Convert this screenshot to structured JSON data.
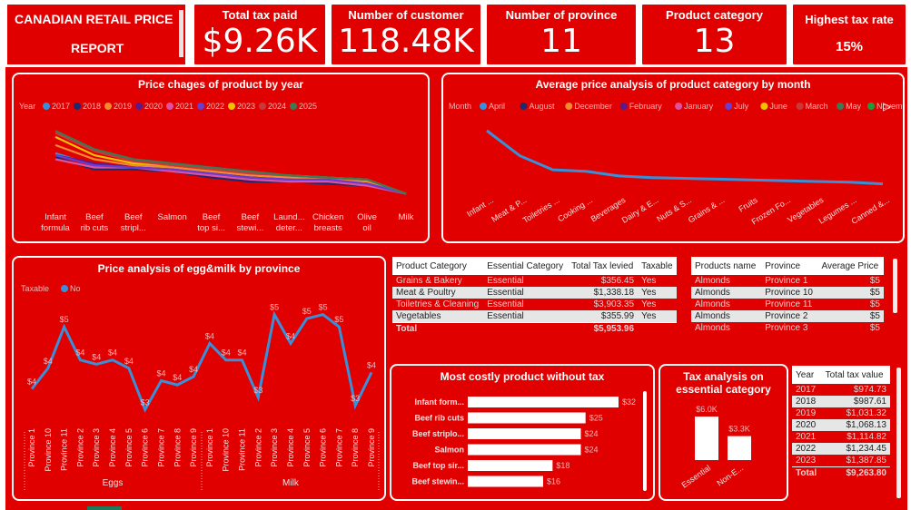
{
  "header": {
    "title_line1": "CANADIAN RETAIL PRICE",
    "title_line2": "REPORT"
  },
  "kpis": [
    {
      "label": "Total tax paid",
      "value": "$9.26K"
    },
    {
      "label": "Number of customer",
      "value": "118.48K"
    },
    {
      "label": "Number of province",
      "value": "11"
    },
    {
      "label": "Product category",
      "value": "13"
    },
    {
      "label": "Highest tax rate",
      "value": "15%"
    }
  ],
  "chart_data": [
    {
      "id": "price_by_year",
      "type": "line",
      "title": "Price chages of product by year",
      "legend_title": "Year",
      "categories": [
        "Infant formula",
        "Beef rib cuts",
        "Beef stripl...",
        "Salmon",
        "Beef top si...",
        "Beef stewi...",
        "Laund... deter...",
        "Chicken breasts",
        "Olive oil",
        "Milk"
      ],
      "series": [
        {
          "name": "2017",
          "color": "#3a8fd9",
          "values": [
            36,
            30,
            29,
            28,
            26,
            24,
            23,
            22,
            21,
            16
          ]
        },
        {
          "name": "2018",
          "color": "#1f2a6b",
          "values": [
            34,
            28,
            28,
            27,
            24,
            22,
            22,
            21,
            20,
            16
          ]
        },
        {
          "name": "2019",
          "color": "#f28a2e",
          "values": [
            40,
            33,
            30,
            29,
            27,
            25,
            24,
            23,
            22,
            16
          ]
        },
        {
          "name": "2020",
          "color": "#5b1a8c",
          "values": [
            35,
            31,
            29,
            28,
            26,
            24,
            23,
            22,
            21,
            16
          ]
        },
        {
          "name": "2021",
          "color": "#e0519e",
          "values": [
            33,
            29,
            29,
            27,
            25,
            23,
            22,
            22,
            20,
            16
          ]
        },
        {
          "name": "2022",
          "color": "#6a3ccf",
          "values": [
            35,
            30,
            29,
            28,
            26,
            24,
            23,
            23,
            21,
            16
          ]
        },
        {
          "name": "2023",
          "color": "#f2c200",
          "values": [
            44,
            35,
            31,
            30,
            28,
            26,
            25,
            24,
            23,
            16
          ]
        },
        {
          "name": "2024",
          "color": "#c8393c",
          "values": [
            46,
            37,
            32,
            30,
            28,
            26,
            25,
            24,
            23,
            16
          ]
        },
        {
          "name": "2025",
          "color": "#3c7a55",
          "values": [
            47,
            38,
            33,
            31,
            29,
            27,
            25,
            24,
            23,
            16
          ]
        }
      ]
    },
    {
      "id": "avg_price_by_month",
      "type": "line",
      "title": "Average price analysis of product category by month",
      "legend_title": "Month",
      "legend": [
        {
          "name": "April",
          "color": "#3a8fd9"
        },
        {
          "name": "August",
          "color": "#1f2a6b"
        },
        {
          "name": "December",
          "color": "#f28a2e"
        },
        {
          "name": "February",
          "color": "#5b1a8c"
        },
        {
          "name": "January",
          "color": "#e0519e"
        },
        {
          "name": "July",
          "color": "#6a3ccf"
        },
        {
          "name": "June",
          "color": "#f2c200"
        },
        {
          "name": "March",
          "color": "#c8393c"
        },
        {
          "name": "May",
          "color": "#3c7a55"
        },
        {
          "name": "November",
          "color": "#1a9e3a"
        }
      ],
      "categories": [
        "Infant ...",
        "Meat & P...",
        "Toiletries ...",
        "Cooking ...",
        "Beverages",
        "Dairy & E...",
        "Nuts & S...",
        "Grains & ...",
        "Fruits",
        "Frozen Fo...",
        "Vegetables",
        "Legumes ...",
        "Canned &..."
      ],
      "values": [
        36,
        20,
        11,
        10,
        7,
        6,
        5.5,
        5,
        4.5,
        4,
        3.5,
        3,
        2
      ]
    },
    {
      "id": "egg_milk_by_province",
      "type": "line",
      "title": "Price analysis of egg&milk by province",
      "legend_title": "Taxable",
      "series_name": "No",
      "groups": [
        {
          "name": "Eggs",
          "categories": [
            "Province 1",
            "Province 10",
            "Province 11",
            "Province 2",
            "Province 3",
            "Province 4",
            "Province 5",
            "Province 6",
            "Province 7",
            "Province 8",
            "Province 9"
          ],
          "values": [
            3.6,
            4.1,
            5.1,
            4.3,
            4.2,
            4.3,
            4.1,
            3.1,
            3.8,
            3.7,
            3.9
          ]
        },
        {
          "name": "Milk",
          "categories": [
            "Province 1",
            "Province 10",
            "Province 11",
            "Province 2",
            "Province 3",
            "Province 4",
            "Province 5",
            "Province 6",
            "Province 7",
            "Province 8",
            "Province 9"
          ],
          "values": [
            4.7,
            4.3,
            4.3,
            3.4,
            5.4,
            4.7,
            5.3,
            5.4,
            5.1,
            3.2,
            4.0
          ]
        }
      ],
      "labels": [
        "$4",
        "$4",
        "$5",
        "$4",
        "$4",
        "$4",
        "$4",
        "$3",
        "$4",
        "$4",
        "$4",
        "$4",
        "$4",
        "$4",
        "$3",
        "$5",
        "$4",
        "$5",
        "$5",
        "$5",
        "$3",
        "$4"
      ]
    },
    {
      "id": "most_costly",
      "type": "bar",
      "title": "Most costly product without tax",
      "categories": [
        "Infant form...",
        "Beef rib cuts",
        "Beef striplo...",
        "Salmon",
        "Beef top sir...",
        "Beef stewin..."
      ],
      "values": [
        32,
        25,
        24,
        24,
        18,
        16
      ],
      "labels": [
        "$32",
        "$25",
        "$24",
        "$24",
        "$18",
        "$16"
      ]
    },
    {
      "id": "tax_essential",
      "type": "bar",
      "title": "Tax analysis on essential category",
      "categories": [
        "Essential",
        "Non-E..."
      ],
      "values": [
        6.0,
        3.3
      ],
      "labels": [
        "$6.0K",
        "$3.3K"
      ]
    }
  ],
  "table_category": {
    "headers": [
      "Product Category",
      "Essential Category",
      "Total Tax levied",
      "Taxable"
    ],
    "rows": [
      [
        "Grains & Bakery",
        "Essential",
        "$356.45",
        "Yes"
      ],
      [
        "Meat & Poultry",
        "Essential",
        "$1,338.18",
        "Yes"
      ],
      [
        "Toiletries & Cleaning",
        "Essential",
        "$3,903.35",
        "Yes"
      ],
      [
        "Vegetables",
        "Essential",
        "$355.99",
        "Yes"
      ]
    ],
    "total_label": "Total",
    "total_value": "$5,953.96"
  },
  "table_products": {
    "headers": [
      "Products name",
      "Province",
      "Average Price"
    ],
    "rows": [
      [
        "Almonds",
        "Province 1",
        "$5"
      ],
      [
        "Almonds",
        "Province 10",
        "$5"
      ],
      [
        "Almonds",
        "Province 11",
        "$5"
      ],
      [
        "Almonds",
        "Province 2",
        "$5"
      ],
      [
        "Almonds",
        "Province 3",
        "$5"
      ]
    ]
  },
  "table_year": {
    "headers": [
      "Year",
      "Total tax value"
    ],
    "rows": [
      [
        "2017",
        "$974.73"
      ],
      [
        "2018",
        "$987.61"
      ],
      [
        "2019",
        "$1,031.32"
      ],
      [
        "2020",
        "$1,068.13"
      ],
      [
        "2021",
        "$1,114.82"
      ],
      [
        "2022",
        "$1,234.45"
      ],
      [
        "2023",
        "$1,387.85"
      ]
    ],
    "total_label": "Total",
    "total_value": "$9,263.80"
  },
  "colors": {
    "bg": "#e00000",
    "border": "#ffffff"
  }
}
